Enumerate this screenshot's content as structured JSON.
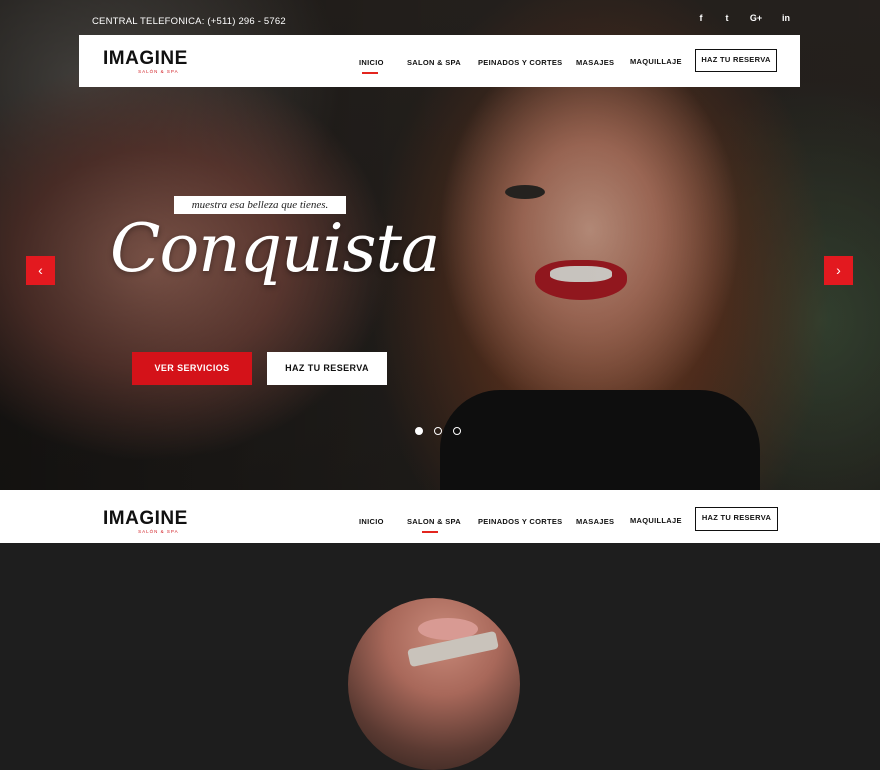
{
  "topbar": {
    "phone": "CENTRAL TELEFONICA: (+511) 296 - 5762",
    "social": [
      "f",
      "t",
      "G+",
      "in"
    ]
  },
  "logo": {
    "main": "IMAGINE",
    "sub": "SALÓN & SPA"
  },
  "nav": {
    "items": [
      "INICIO",
      "SALON & SPA",
      "PEINADOS Y CORTES",
      "MASAJES",
      "MAQUILLAJE"
    ],
    "reserve": "HAZ TU RESERVA"
  },
  "hero": {
    "tagline": "muestra esa belleza que tienes.",
    "title": "Conquista",
    "btn_primary": "VER SERVICIOS",
    "btn_secondary": "HAZ TU RESERVA",
    "slides_total": 3,
    "active_slide": 1
  },
  "colors": {
    "accent": "#e3191f",
    "dark": "#1e1e1e"
  },
  "icons": {
    "prev": "chevron-left-icon",
    "next": "chevron-right-icon",
    "facebook": "facebook-icon",
    "twitter": "twitter-icon",
    "google": "google-plus-icon",
    "linkedin": "linkedin-icon"
  }
}
